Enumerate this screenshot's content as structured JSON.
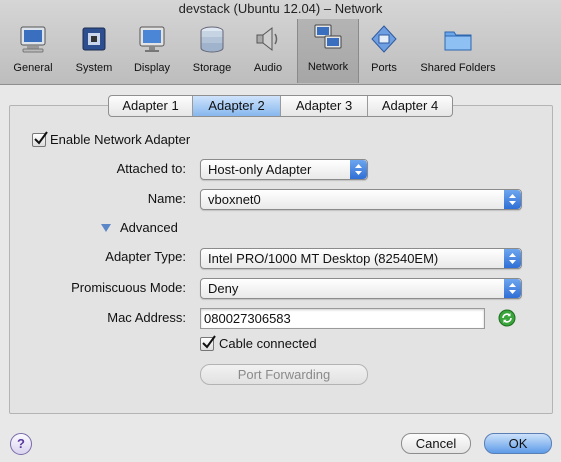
{
  "window": {
    "title": "devstack (Ubuntu 12.04) – Network"
  },
  "toolbar": {
    "items": [
      {
        "label": "General",
        "icon": "monitor-icon"
      },
      {
        "label": "System",
        "icon": "chip-icon"
      },
      {
        "label": "Display",
        "icon": "display-icon"
      },
      {
        "label": "Storage",
        "icon": "disk-stack-icon"
      },
      {
        "label": "Audio",
        "icon": "speaker-icon"
      },
      {
        "label": "Network",
        "icon": "network-icon"
      },
      {
        "label": "Ports",
        "icon": "port-icon"
      },
      {
        "label": "Shared Folders",
        "icon": "folder-icon"
      }
    ],
    "selected": "Network"
  },
  "tabs": [
    "Adapter 1",
    "Adapter 2",
    "Adapter 3",
    "Adapter 4"
  ],
  "active_tab": "Adapter 2",
  "form": {
    "enable_label": "Enable Network Adapter",
    "attached_label": "Attached to:",
    "attached_value": "Host-only Adapter",
    "name_label": "Name:",
    "name_value": "vboxnet0",
    "advanced_label": "Advanced",
    "adapter_type_label": "Adapter Type:",
    "adapter_type_value": "Intel PRO/1000 MT Desktop (82540EM)",
    "promiscuous_label": "Promiscuous Mode:",
    "promiscuous_value": "Deny",
    "mac_label": "Mac Address:",
    "mac_value": "080027306583",
    "cable_label": "Cable connected",
    "port_forwarding_label": "Port Forwarding"
  },
  "footer": {
    "help": "?",
    "cancel": "Cancel",
    "ok": "OK"
  },
  "colors": {
    "accent": "#3c7fe0",
    "refresh": "#2e9a2e"
  }
}
